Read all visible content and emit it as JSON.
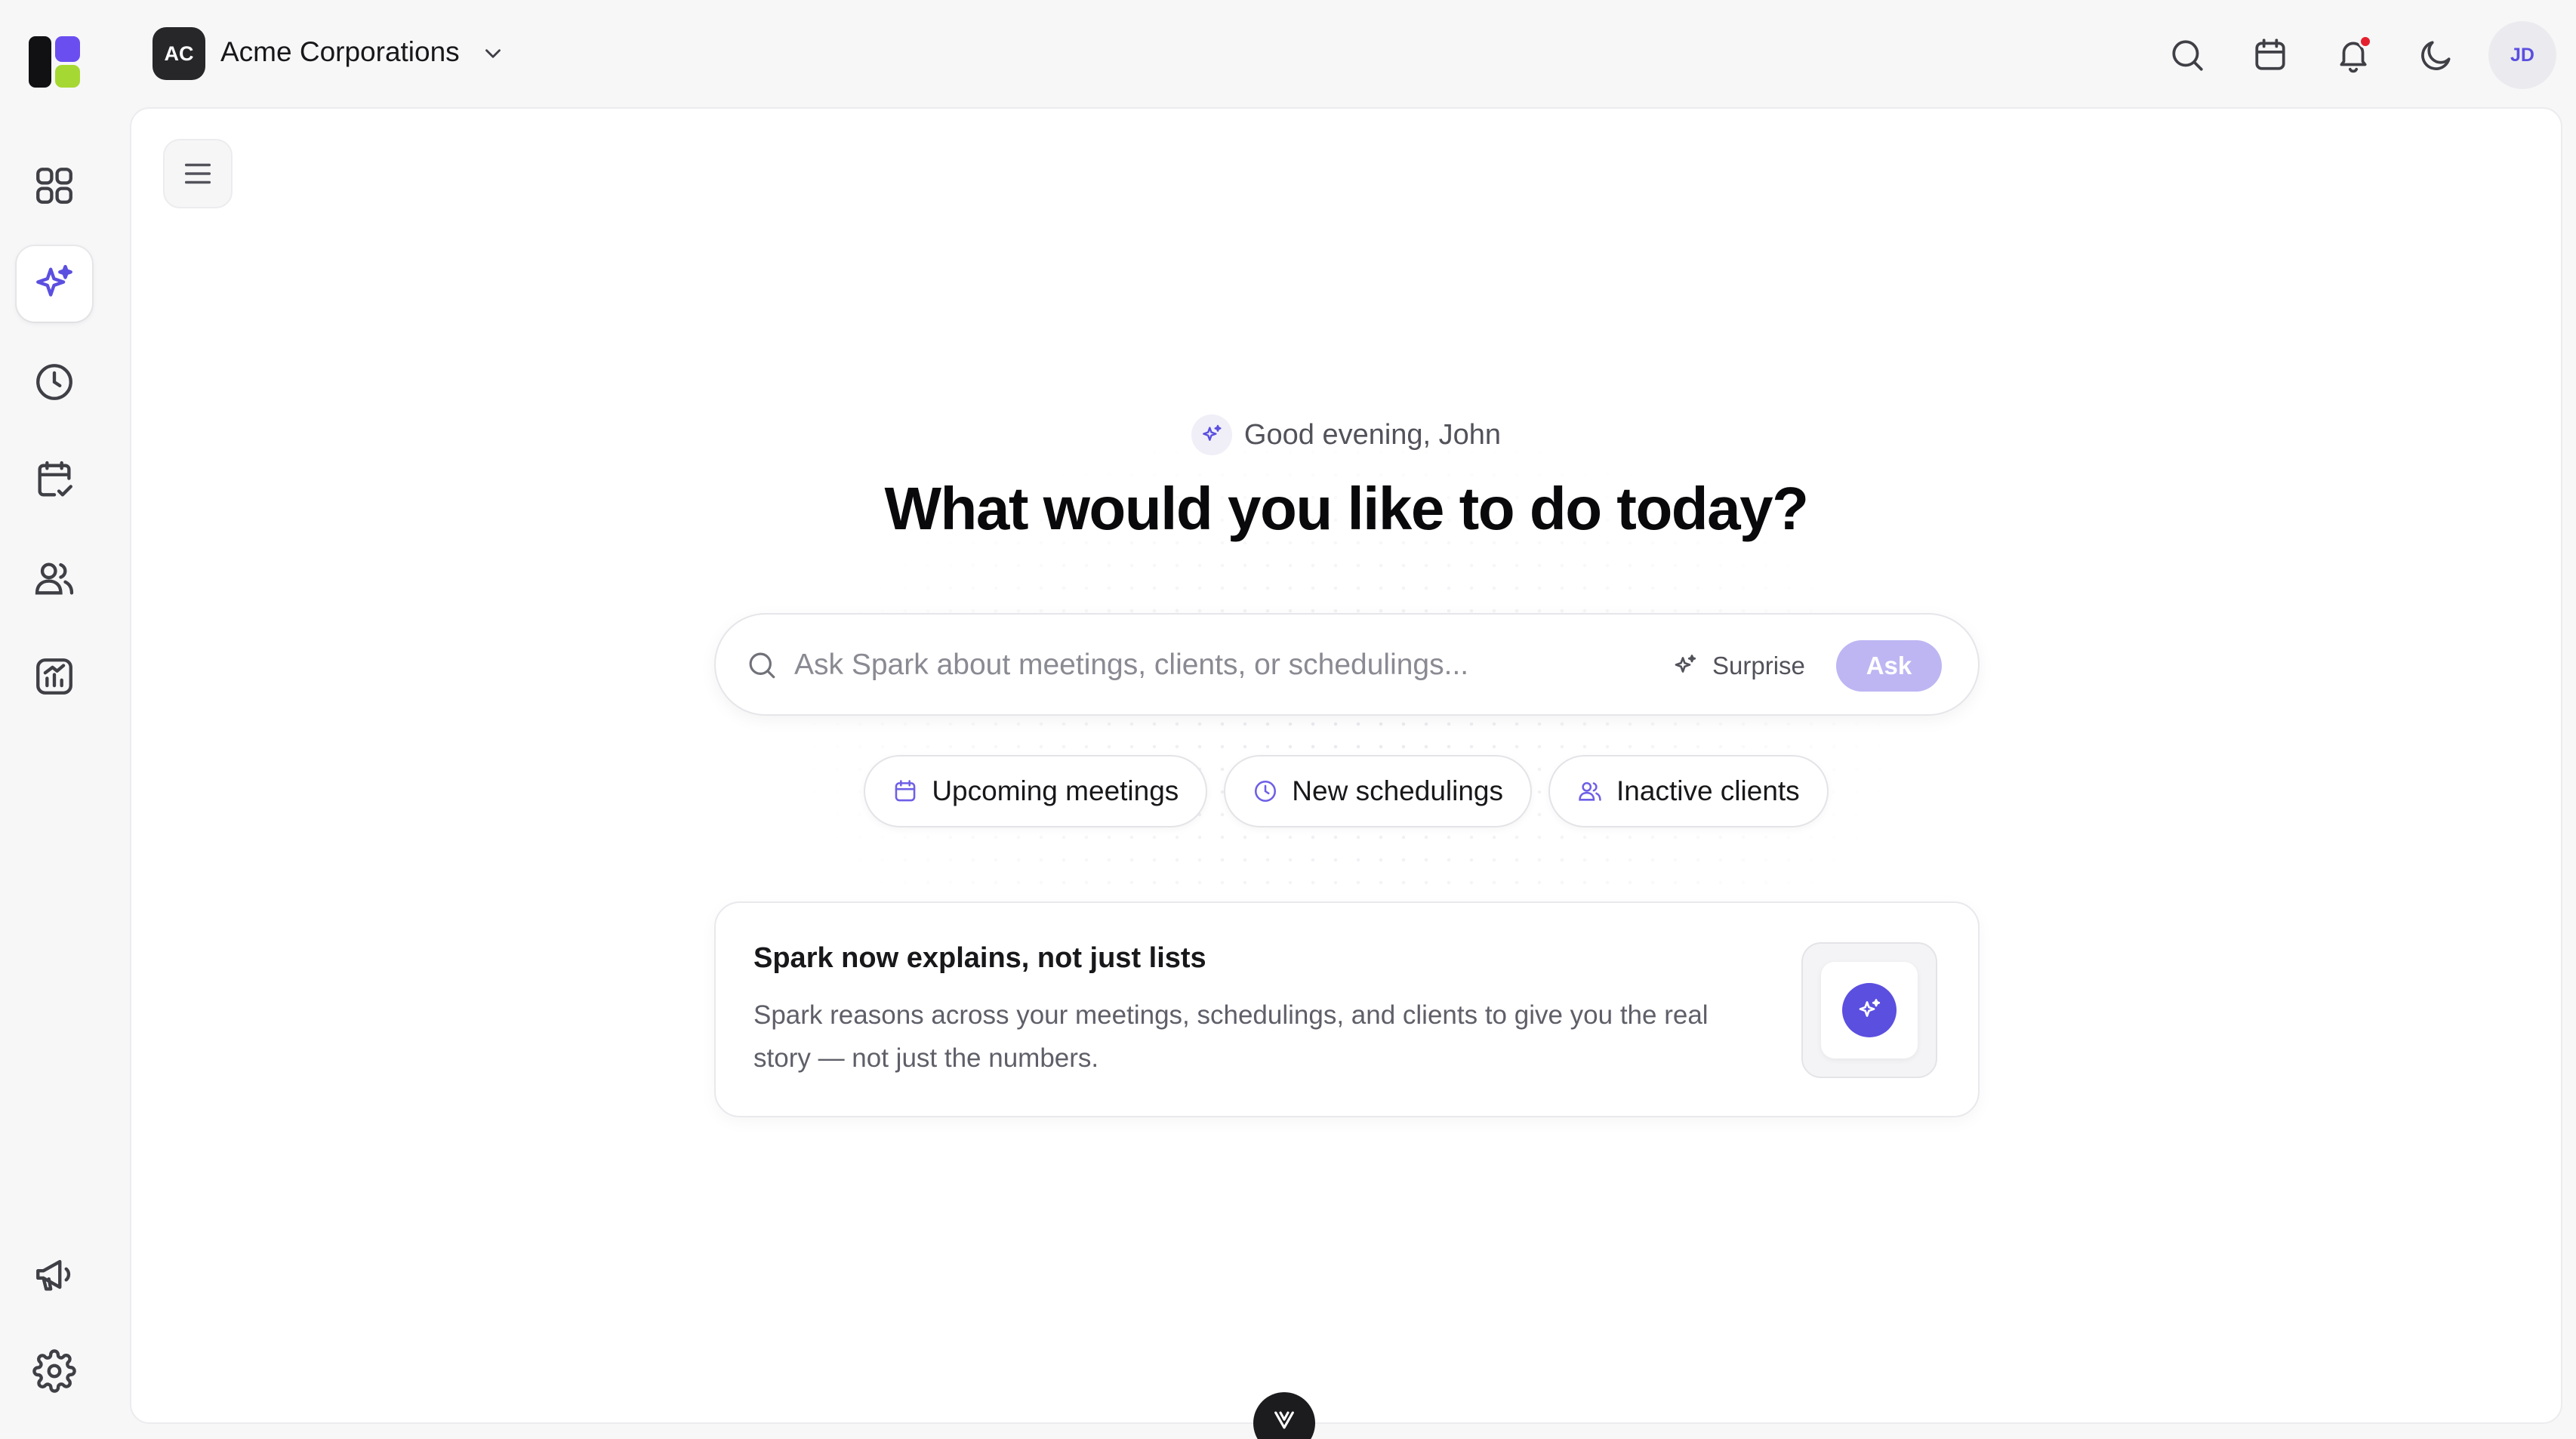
{
  "org": {
    "badge": "AC",
    "name": "Acme Corporations"
  },
  "user": {
    "initials": "JD"
  },
  "rail": {
    "items": [
      {
        "name": "dashboard",
        "icon": "grid-icon",
        "active": false
      },
      {
        "name": "spark",
        "icon": "sparkles-icon",
        "active": true
      },
      {
        "name": "history",
        "icon": "clock-icon",
        "active": false
      },
      {
        "name": "schedule",
        "icon": "calendar-check-icon",
        "active": false
      },
      {
        "name": "clients",
        "icon": "users-icon",
        "active": false
      },
      {
        "name": "analytics",
        "icon": "chart-icon",
        "active": false
      },
      {
        "name": "announcements",
        "icon": "megaphone-icon",
        "active": false
      },
      {
        "name": "settings",
        "icon": "gear-icon",
        "active": false
      }
    ]
  },
  "topbar": {
    "icons": [
      "search-icon",
      "calendar-icon",
      "bell-icon",
      "moon-icon"
    ],
    "has_notification": true
  },
  "main": {
    "greeting": "Good evening, John",
    "headline": "What would you like to do today?",
    "search": {
      "placeholder": "Ask Spark about meetings, clients, or schedulings...",
      "value": "",
      "surprise_label": "Surprise",
      "ask_label": "Ask"
    },
    "chips": [
      {
        "label": "Upcoming meetings",
        "icon": "calendar-icon"
      },
      {
        "label": "New schedulings",
        "icon": "clock-icon"
      },
      {
        "label": "Inactive clients",
        "icon": "users-icon"
      }
    ],
    "info_card": {
      "title": "Spark now explains, not just lists",
      "body": "Spark reasons across your meetings, schedulings, and clients to give you the real story — not just the numbers."
    }
  },
  "colors": {
    "accent": "#5b4fe0",
    "ask_button": "#bdb6f3",
    "notification": "#e5202e",
    "background": "#f7f7f8"
  }
}
